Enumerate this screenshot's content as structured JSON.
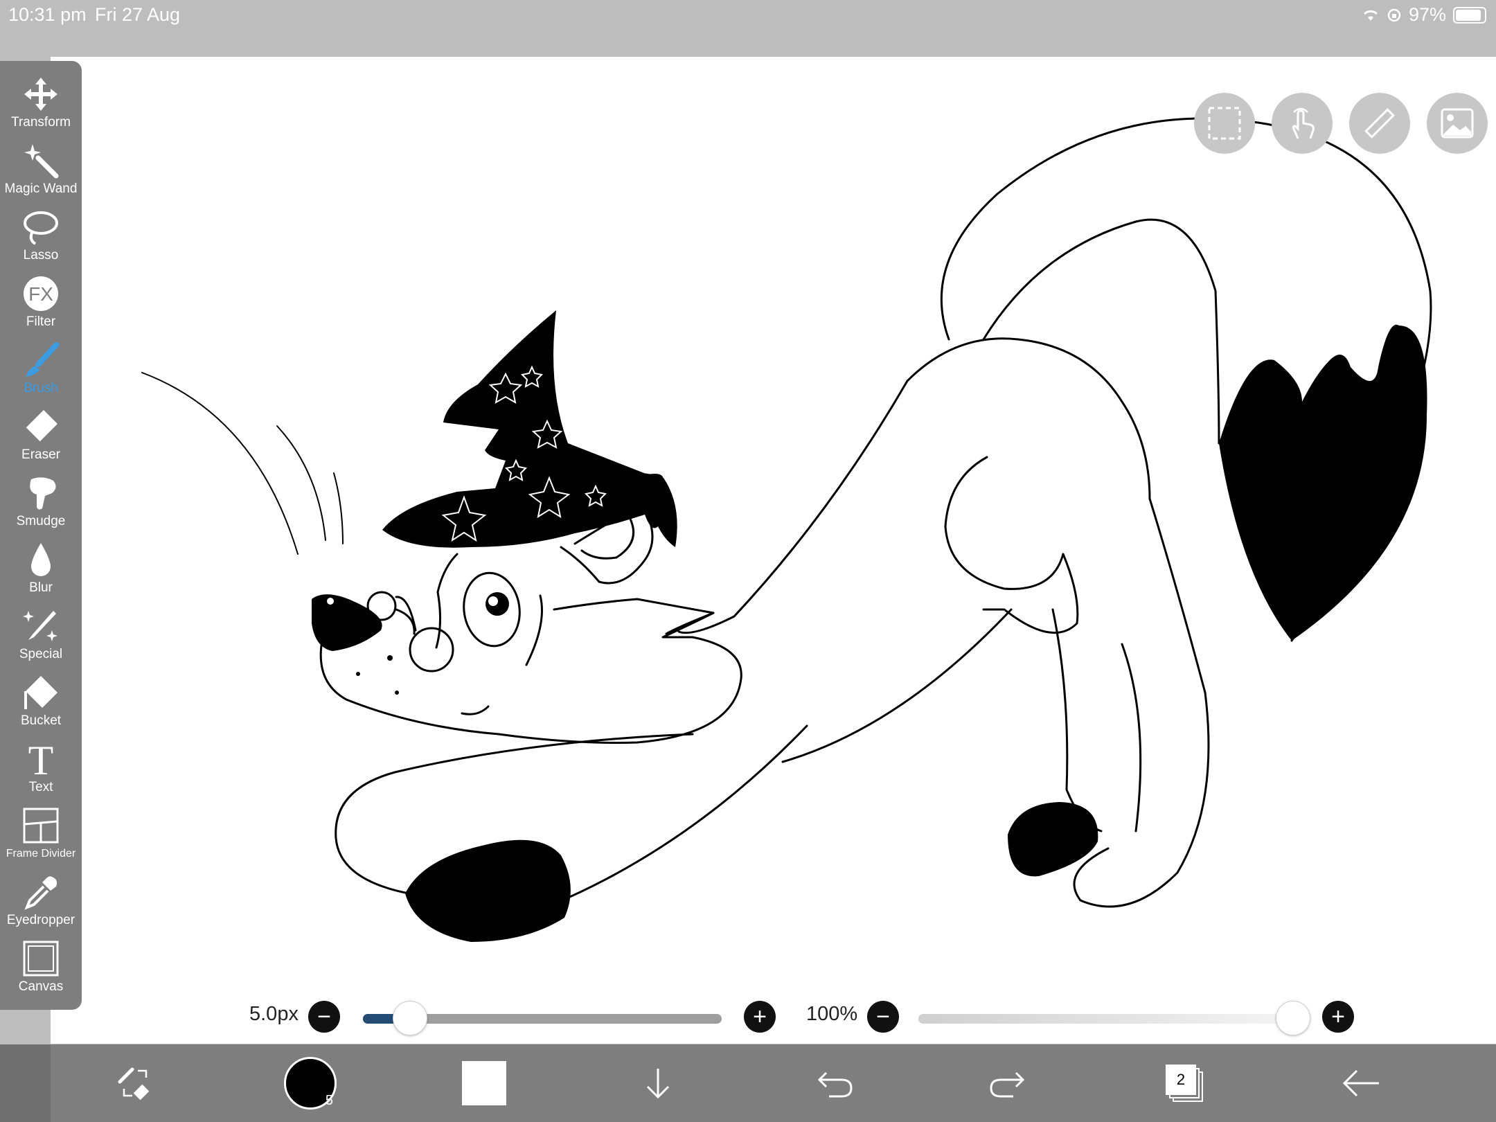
{
  "status_bar": {
    "time": "10:31 pm",
    "date": "Fri 27 Aug",
    "battery": "97%"
  },
  "left_toolbar": {
    "tools": [
      {
        "label": "Transform",
        "icon": "move-arrows-icon"
      },
      {
        "label": "Magic Wand",
        "icon": "magic-wand-icon"
      },
      {
        "label": "Lasso",
        "icon": "lasso-icon"
      },
      {
        "label": "Filter",
        "icon": "fx-icon"
      },
      {
        "label": "Brush",
        "icon": "brush-icon",
        "active": true
      },
      {
        "label": "Eraser",
        "icon": "eraser-icon"
      },
      {
        "label": "Smudge",
        "icon": "smudge-icon"
      },
      {
        "label": "Blur",
        "icon": "droplet-icon"
      },
      {
        "label": "Special",
        "icon": "sparkle-pen-icon"
      },
      {
        "label": "Bucket",
        "icon": "bucket-icon"
      },
      {
        "label": "Text",
        "icon": "text-icon"
      },
      {
        "label": "Frame Divider",
        "icon": "frame-divider-icon"
      },
      {
        "label": "Eyedropper",
        "icon": "eyedropper-icon"
      },
      {
        "label": "Canvas",
        "icon": "canvas-icon"
      }
    ]
  },
  "top_right_buttons": [
    "selection-icon",
    "touch-gesture-icon",
    "ruler-icon",
    "image-icon"
  ],
  "sliders": {
    "brush_size": {
      "label": "5.0px",
      "fraction": 0.13
    },
    "opacity": {
      "label": "100%",
      "fraction": 1.0
    },
    "minus": "−",
    "plus": "+"
  },
  "bottom_toolbar": {
    "brush_color": "#000000",
    "brush_size_badge": "5",
    "layers_count": "2",
    "icons": [
      "swap-tools-icon",
      "color-swatch-icon",
      "secondary-color-icon",
      "download-icon",
      "undo-icon",
      "redo-icon",
      "layers-icon",
      "back-arrow-icon"
    ]
  },
  "colors": {
    "toolbar_bg": "#7e7e7e",
    "active_tool": "#3d9be0",
    "status_bg": "#bdbdbd",
    "slider_fill": "#234b73"
  }
}
